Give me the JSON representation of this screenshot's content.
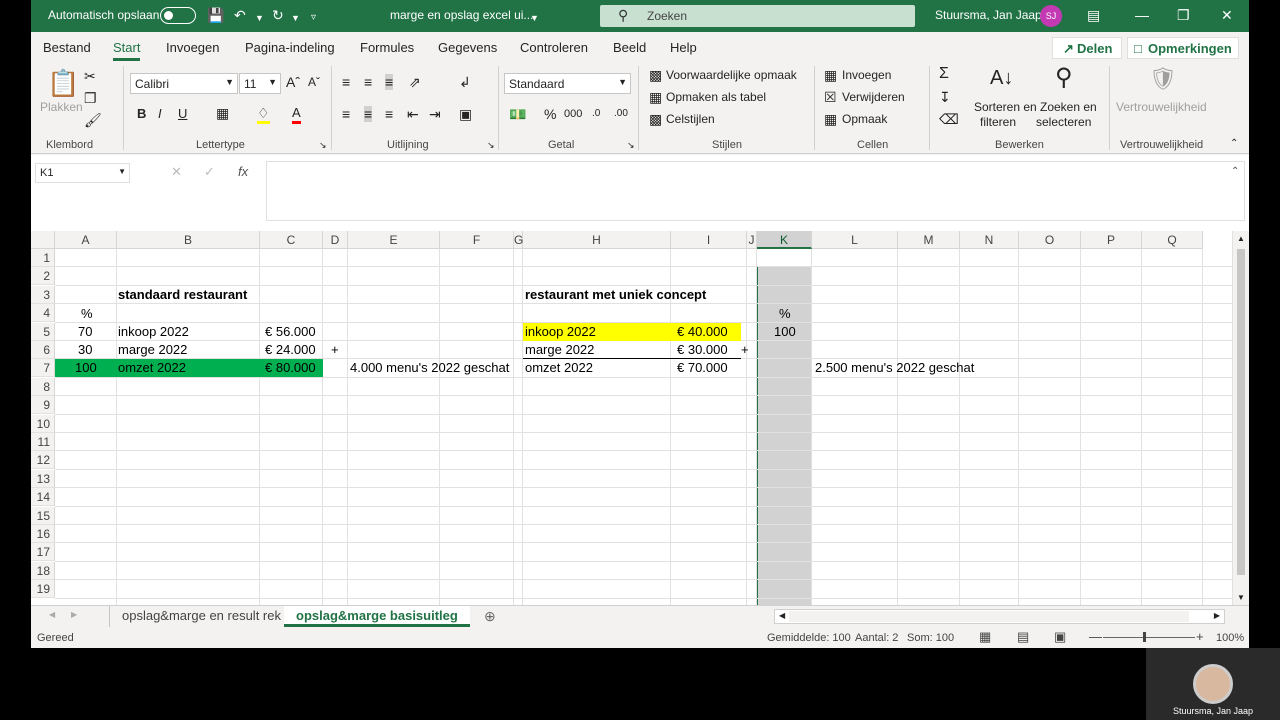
{
  "titlebar": {
    "autosave_label": "Automatisch opslaan",
    "doc_title": "marge en opslag excel ui...",
    "search_placeholder": "Zoeken",
    "user_name": "Stuursma, Jan Jaap",
    "user_initials": "SJ"
  },
  "tabs": [
    "Bestand",
    "Start",
    "Invoegen",
    "Pagina-indeling",
    "Formules",
    "Gegevens",
    "Controleren",
    "Beeld",
    "Help"
  ],
  "share_label": "Delen",
  "comments_label": "Opmerkingen",
  "ribbon": {
    "clipboard": {
      "paste": "Plakken",
      "label": "Klembord"
    },
    "font": {
      "name": "Calibri",
      "size": "11",
      "bold": "B",
      "italic": "I",
      "underline": "U",
      "label": "Lettertype"
    },
    "alignment": {
      "label": "Uitlijning"
    },
    "number": {
      "format": "Standaard",
      "label": "Getal"
    },
    "styles": {
      "conditional": "Voorwaardelijke opmaak",
      "as_table": "Opmaken als tabel",
      "cell_styles": "Celstijlen",
      "label": "Stijlen"
    },
    "cells": {
      "insert": "Invoegen",
      "delete": "Verwijderen",
      "format": "Opmaak",
      "label": "Cellen"
    },
    "editing": {
      "sort": "Sorteren en",
      "sort2": "filteren",
      "find": "Zoeken en",
      "find2": "selecteren",
      "label": "Bewerken"
    },
    "sensitivity": {
      "name": "Vertrouwelijkheid",
      "label": "Vertrouwelijkheid"
    }
  },
  "formula": {
    "namebox": "K1",
    "fx": "fx",
    "value": ""
  },
  "columns": [
    "A",
    "B",
    "C",
    "D",
    "E",
    "F",
    "G",
    "H",
    "I",
    "J",
    "K",
    "L",
    "M",
    "N",
    "O",
    "P",
    "Q"
  ],
  "rows": [
    "1",
    "2",
    "3",
    "4",
    "5",
    "6",
    "7",
    "8",
    "9",
    "10",
    "11",
    "12",
    "13",
    "14",
    "15",
    "16",
    "17",
    "18",
    "19"
  ],
  "cells": {
    "B3": "standaard restaurant",
    "A4": "%",
    "A5": "70",
    "B5": "inkoop 2022",
    "C5": "€  56.000",
    "A6": "30",
    "B6": "marge 2022",
    "C6": "€  24.000",
    "D6": "+",
    "A7": "100",
    "B7": "omzet 2022",
    "C7": "€  80.000",
    "E7": "4.000 menu's 2022 geschat",
    "H3": "restaurant met uniek concept",
    "K4": "%",
    "H5": "inkoop 2022",
    "I5": "€    40.000",
    "K5": "100",
    "H6": "marge 2022",
    "I6": "€    30.000",
    "J6": "+",
    "H7": "omzet 2022",
    "I7": "€    70.000",
    "L7": "2.500 menu's 2022 geschat"
  },
  "colors": {
    "excel_green": "#217346",
    "highlight_green": "#00b050",
    "highlight_yellow": "#ffff00"
  },
  "sheets": [
    "opslag&marge en result rek",
    "opslag&marge basisuitleg"
  ],
  "active_sheet": 1,
  "status": {
    "ready": "Gereed",
    "average": "Gemiddelde: 100",
    "count": "Aantal: 2",
    "sum": "Som: 100",
    "zoom": "100%"
  },
  "webcam_name": "Stuursma, Jan Jaap"
}
